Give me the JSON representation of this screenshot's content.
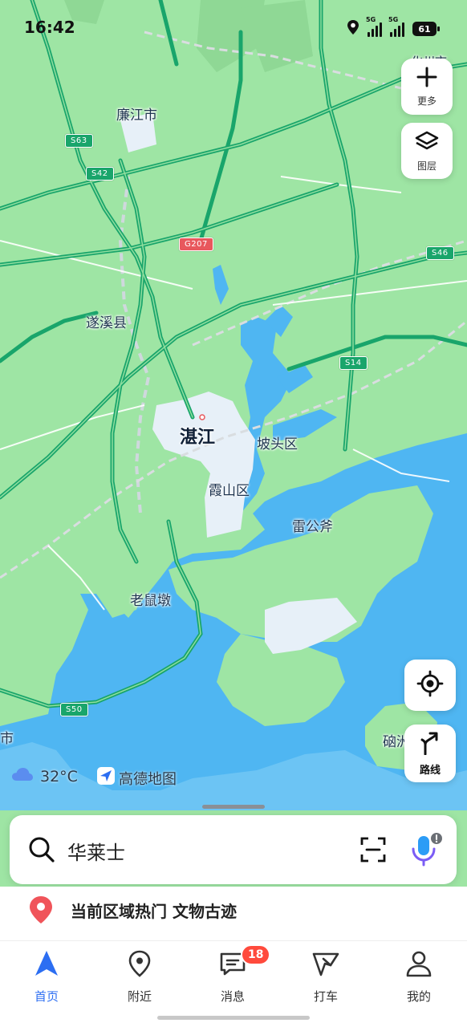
{
  "status_bar": {
    "time": "16:42",
    "signal1_tag": "5G",
    "signal2_tag": "5G",
    "battery": "61"
  },
  "map": {
    "labels": {
      "lianjiang": "廉江市",
      "suixi": "遂溪县",
      "zhanjiang": "湛江",
      "potou": "坡头区",
      "xiashan": "霞山区",
      "leigongfu": "雷公斧",
      "laoshudun": "老鼠墩",
      "naozhou": "硇洲",
      "edge_left": "市",
      "edge_top": "化州市"
    },
    "shields": {
      "s63": "S63",
      "s42": "S42",
      "g207": "G207",
      "s46": "S46",
      "s14": "S14",
      "s50": "S50"
    }
  },
  "controls": {
    "more_label": "更多",
    "layers_label": "图层",
    "route_label": "路线"
  },
  "weather": {
    "temperature": "32°C",
    "brand": "高德地图"
  },
  "search": {
    "query": "华莱士"
  },
  "hot": {
    "text": "当前区域热门 文物古迹"
  },
  "tabs": [
    {
      "label": "首页"
    },
    {
      "label": "附近"
    },
    {
      "label": "消息",
      "badge": "18"
    },
    {
      "label": "打车"
    },
    {
      "label": "我的"
    }
  ],
  "colors": {
    "land": "#9ee5a4",
    "water": "#4fb6f2",
    "road": "#19a56b",
    "accent": "#2c6ef2"
  }
}
